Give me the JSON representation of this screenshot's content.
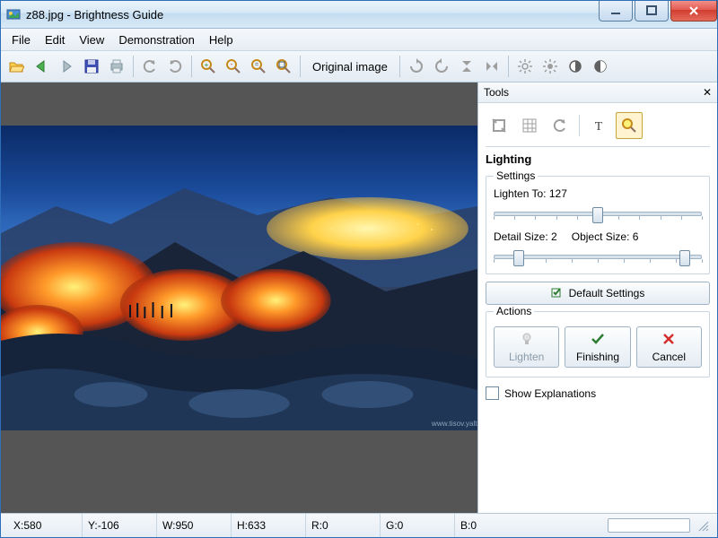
{
  "window": {
    "title": "z88.jpg - Brightness Guide"
  },
  "menu": {
    "items": [
      "File",
      "Edit",
      "View",
      "Demonstration",
      "Help"
    ]
  },
  "toolbar": {
    "original_label": "Original image"
  },
  "tools_panel": {
    "title": "Tools",
    "section": "Lighting",
    "settings_legend": "Settings",
    "lighten_label": "Lighten To:",
    "lighten_value": "127",
    "detail_label": "Detail Size:",
    "detail_value": "2",
    "object_label": "Object Size:",
    "object_value": "6",
    "default_btn": "Default Settings",
    "actions_legend": "Actions",
    "lighten_btn": "Lighten",
    "finishing_btn": "Finishing",
    "cancel_btn": "Cancel",
    "show_explanations": "Show Explanations"
  },
  "status": {
    "x_label": "X:",
    "x_value": "580",
    "y_label": "Y:",
    "y_value": "-106",
    "w_label": "W:",
    "w_value": "950",
    "h_label": "H:",
    "h_value": "633",
    "r_label": "R:",
    "r_value": "0",
    "g_label": "G:",
    "g_value": "0",
    "b_label": "B:",
    "b_value": "0"
  },
  "colors": {
    "accent": "#fff4cf",
    "panel_border": "#c8d6e2"
  }
}
